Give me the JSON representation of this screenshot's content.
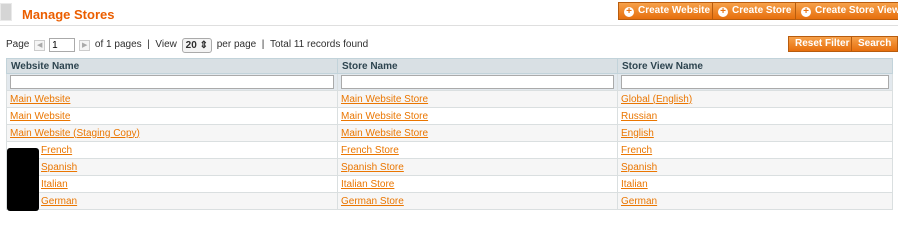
{
  "header": {
    "title": "Manage Stores",
    "buttons": {
      "create_website": "Create Website",
      "create_store": "Create Store",
      "create_store_view": "Create Store View"
    }
  },
  "pager": {
    "page_label": "Page",
    "page_value": "1",
    "of_pages": "of 1 pages",
    "separator": "|",
    "view_label": "View",
    "per_page_value": "20",
    "per_page_label": "per page",
    "total": "Total 11 records found"
  },
  "actions": {
    "reset_filter": "Reset Filter",
    "search": "Search"
  },
  "columns": [
    "Website Name",
    "Store Name",
    "Store View Name"
  ],
  "rows": [
    [
      "Main Website",
      "Main Website Store",
      "Global (English)"
    ],
    [
      "Main Website",
      "Main Website Store",
      "Russian"
    ],
    [
      "Main Website (Staging Copy)",
      "Main Website Store",
      "English"
    ],
    [
      "French",
      "French Store",
      "French"
    ],
    [
      "Spanish",
      "Spanish Store",
      "Spanish"
    ],
    [
      "Italian",
      "Italian Store",
      "Italian"
    ],
    [
      "German",
      "German Store",
      "German"
    ]
  ],
  "colors": {
    "accent": "#eb5e00",
    "link": "#ea7601",
    "header_bg": "#d9e0e4"
  }
}
